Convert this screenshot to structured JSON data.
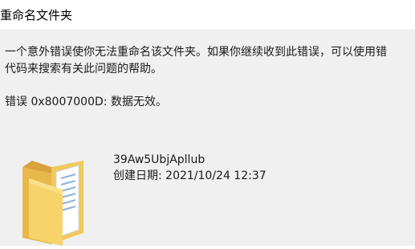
{
  "window": {
    "title": "重命名文件夹"
  },
  "message": {
    "line1": "一个意外错误使你无法重命名该文件夹。如果你继续收到此错误，可以使用错",
    "line2": "代码来搜索有关此问题的帮助。"
  },
  "error": {
    "text": "错误 0x8007000D: 数据无效。"
  },
  "file": {
    "icon": "folder-icon",
    "name": "39Aw5UbjApllub",
    "created": "创建日期: 2021/10/24 12:37"
  }
}
